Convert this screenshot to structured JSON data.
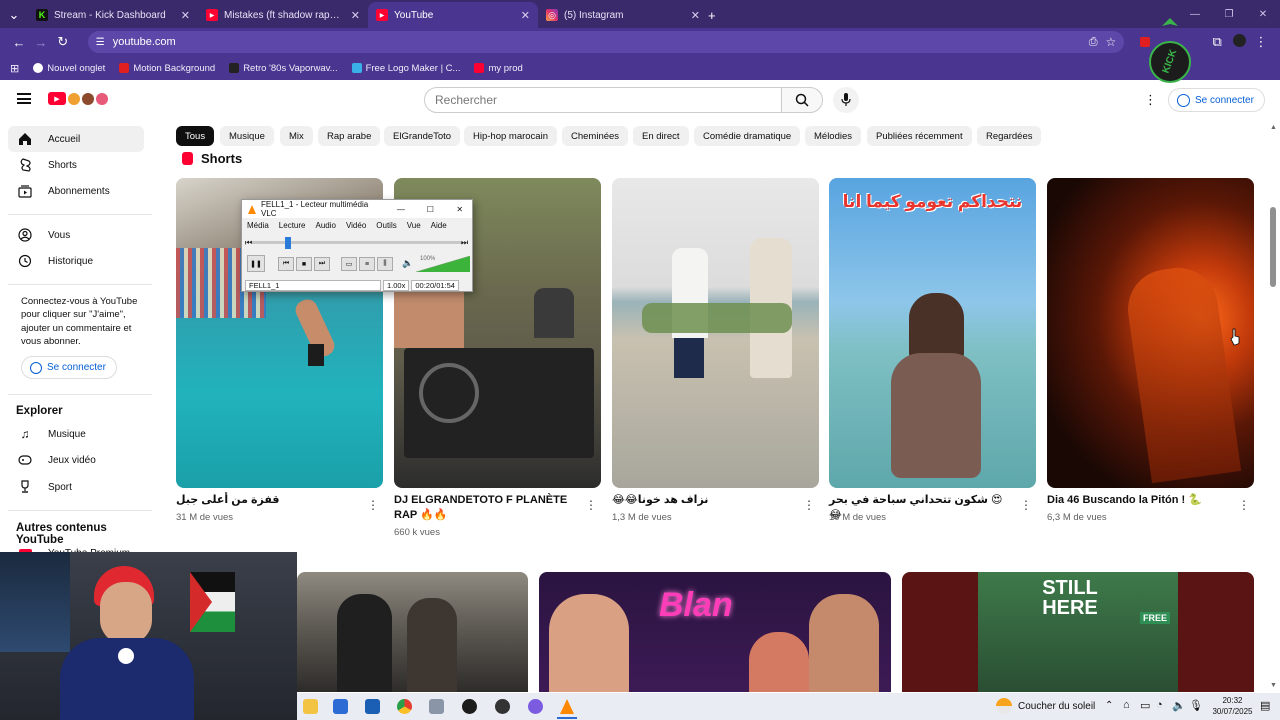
{
  "browser": {
    "tabs": [
      {
        "label": "Stream - Kick Dashboard",
        "icon": "K",
        "icon_color": "#53fc18",
        "active": false
      },
      {
        "label": "Mistakes (ft shadow rapper & ...",
        "icon": "▶",
        "icon_color": "#ff0033",
        "active": false
      },
      {
        "label": "YouTube",
        "icon": "▶",
        "icon_color": "#ff0033",
        "active": true
      },
      {
        "label": "(5) Instagram",
        "icon": "◎",
        "icon_color": "#e1306c",
        "active": false
      }
    ],
    "url": "youtube.com",
    "bookmarks": [
      {
        "label": "Nouvel onglet",
        "color": "#ffffff"
      },
      {
        "label": "Motion Background",
        "color": "#e02020"
      },
      {
        "label": "Retro '80s Vaporwav...",
        "color": "#222222"
      },
      {
        "label": "Free Logo Maker | C...",
        "color": "#3ab0e8"
      },
      {
        "label": "my prod",
        "color": "#ff0033"
      }
    ]
  },
  "yt": {
    "search_placeholder": "Rechercher",
    "signin_label": "Se connecter",
    "chips": [
      "Tous",
      "Musique",
      "Mix",
      "Rap arabe",
      "ElGrandeToto",
      "Hip-hop marocain",
      "Cheminées",
      "En direct",
      "Comédie dramatique",
      "Mélodies",
      "Publiées récemment",
      "Regardées"
    ],
    "sidebar": {
      "items": [
        {
          "label": "Accueil",
          "icon": "home-icon"
        },
        {
          "label": "Shorts",
          "icon": "shorts-icon"
        },
        {
          "label": "Abonnements",
          "icon": "subscriptions-icon"
        },
        {
          "label": "Vous",
          "icon": "user-icon"
        },
        {
          "label": "Historique",
          "icon": "history-icon"
        }
      ],
      "signin_prompt": "Connectez-vous à YouTube pour cliquer sur \"J'aime\", ajouter un commentaire et vous abonner.",
      "signin_label": "Se connecter",
      "explore_title": "Explorer",
      "explore_items": [
        {
          "label": "Musique",
          "icon": "music-icon"
        },
        {
          "label": "Jeux vidéo",
          "icon": "gaming-icon"
        },
        {
          "label": "Sport",
          "icon": "trophy-icon"
        }
      ],
      "other_title": "Autres contenus YouTube",
      "other_items": [
        {
          "label": "YouTube Premium"
        }
      ]
    },
    "shorts_heading": "Shorts",
    "shorts": [
      {
        "title": "قفزة من أعلى جبل",
        "views": "31 M de vues"
      },
      {
        "title": "DJ ELGRANDETOTO F PLANÈTE RAP 🔥🔥",
        "views": "660 k vues"
      },
      {
        "title": "😂😂نزاف هد خونا",
        "views": "1,3 M de vues"
      },
      {
        "title": "شكون تتحداني سباحة في بحر 😍😂",
        "views": "10 M de vues"
      },
      {
        "title": "Dia 46 Buscando la Pitón ! 🐍",
        "views": "6,3 M de vues"
      }
    ],
    "short_overlay_text": "نتحداكم تعومو كيما انا",
    "bottom_texts": {
      "blan": "Blan",
      "still_here": "STILL HERE",
      "free": "FREE"
    }
  },
  "vlc": {
    "title": "FELL1_1 - Lecteur multimédia VLC",
    "menu": [
      "Média",
      "Lecture",
      "Audio",
      "Vidéo",
      "Outils",
      "Vue",
      "Aide"
    ],
    "filename": "FELL1_1",
    "speed": "1.00x",
    "time": "00:20/01:54",
    "volume": "100%",
    "progress": 0.175
  },
  "taskbar": {
    "weather": "Coucher du soleil",
    "time": "20:32",
    "date": "30/07/2025"
  },
  "overlay_logo_text": "KICK"
}
